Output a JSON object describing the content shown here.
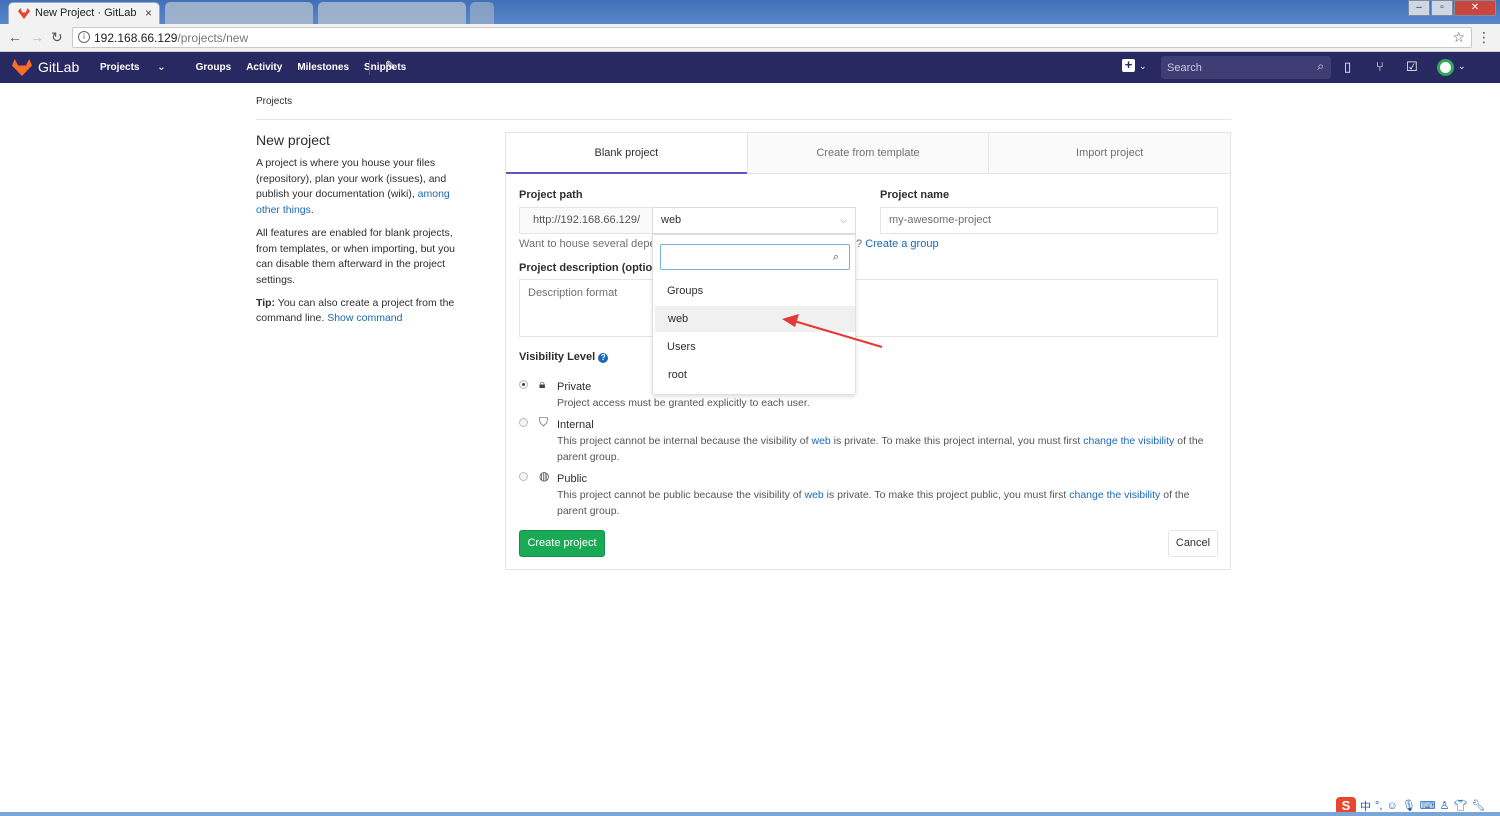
{
  "browser": {
    "tab_title": "New Project · GitLab",
    "url_host": "192.168.66.129",
    "url_path": "/projects/new"
  },
  "gitlab_nav": {
    "brand": "GitLab",
    "items": [
      "Projects",
      "Groups",
      "Activity",
      "Milestones",
      "Snippets"
    ],
    "search_placeholder": "Search"
  },
  "breadcrumb": "Projects",
  "sidebar": {
    "title": "New project",
    "para1": "A project is where you house your files (repository), plan your work (issues), and publish your documentation (wiki),",
    "para1_link": "among other things",
    "para2": "All features are enabled for blank projects, from templates, or when importing, but you can disable them afterward in the project settings.",
    "tip_label": "Tip:",
    "tip_text": "You can also create a project from the command line.",
    "tip_link": "Show command"
  },
  "tabs": [
    "Blank project",
    "Create from template",
    "Import project"
  ],
  "form": {
    "path_label": "Project path",
    "path_prefix": "http://192.168.66.129/",
    "namespace_value": "web",
    "name_label": "Project name",
    "name_placeholder": "my-awesome-project",
    "hint_left": "Want to house several depe",
    "hint_right": "?",
    "hint_link": "Create a group",
    "description_label": "Project description (option",
    "description_placeholder": "Description format",
    "visibility_label": "Visibility Level",
    "visibility": [
      {
        "title": "Private",
        "desc": "Project access must be granted explicitly to each user.",
        "selected": true
      },
      {
        "title": "Internal",
        "desc1": "This project cannot be internal because the visibility of",
        "link1": "web",
        "desc2": "is private. To make this project internal, you must first",
        "link2": "change the visibility",
        "desc3": "of the parent group.",
        "selected": false
      },
      {
        "title": "Public",
        "desc1": "This project cannot be public because the visibility of",
        "link1": "web",
        "desc2": "is private. To make this project public, you must first",
        "link2": "change the visibility",
        "desc3": "of the parent group.",
        "selected": false
      }
    ],
    "create_button": "Create project",
    "cancel_button": "Cancel"
  },
  "dropdown": {
    "groups_header": "Groups",
    "groups": [
      "web"
    ],
    "users_header": "Users",
    "users": [
      "root"
    ]
  },
  "colors": {
    "header": "#292961",
    "accent_tab": "#6b4fbb",
    "create_button": "#1aaa55",
    "link": "#1b69b6",
    "annotation_arrow": "#e53935"
  }
}
